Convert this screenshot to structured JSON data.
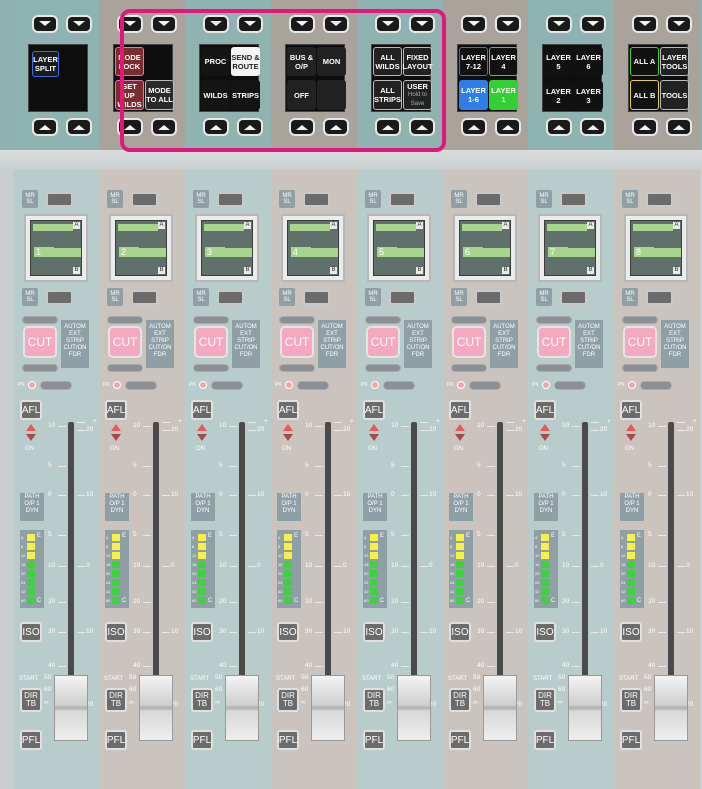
{
  "topbar": {
    "panels": [
      {
        "keys": [
          "LAYER SPLIT"
        ]
      },
      {
        "keys": [
          "MODE LOCK",
          "SET UP WILDS",
          "MODE TO ALL"
        ]
      },
      {
        "keys": [
          "PROC",
          "SEND & ROUTE",
          "WILDS",
          "STRIPS"
        ]
      },
      {
        "keys": [
          "BUS & O/P",
          "MON",
          "OFF"
        ]
      },
      {
        "keys": [
          "ALL WILDS",
          "FIXED LAYOUT",
          "ALL STRIPS",
          "USER",
          "Hold to Save"
        ]
      },
      {
        "keys": [
          "LAYER 7-12",
          "LAYER 4",
          "LAYER 1-6",
          "LAYER 1"
        ]
      },
      {
        "keys": [
          "LAYER 5",
          "LAYER 6",
          "LAYER 2",
          "LAYER 3"
        ]
      },
      {
        "keys": [
          "ALL A",
          "LAYER TOOLS",
          "ALL B",
          "TOOLS"
        ]
      }
    ],
    "highlight_color": "#e1187a"
  },
  "strips": {
    "channel_numbers": [
      "1",
      "2",
      "3",
      "4",
      "5",
      "6",
      "7",
      "8"
    ],
    "lcd_letters": {
      "a": "A",
      "b": "B"
    },
    "mr_sl": "MR SL",
    "cut_label": "CUT",
    "autom_label": "AUTOM EXT STRIP CUT/ON FDR",
    "pk_label": "PK",
    "afl_label": "AFL",
    "on_label": "ON",
    "path_label": "PATH O/P 1 DYN",
    "meter_labels": [
      "4",
      "8",
      "12",
      "16",
      "20",
      "24",
      "42",
      "60"
    ],
    "meter_letters": {
      "e": "E",
      "c": "C"
    },
    "iso_label": "ISO",
    "start_label": "START",
    "dirtb_label": "DIR TB",
    "pfl_label": "PFL",
    "scale_left": [
      "10",
      "5",
      "0",
      "5",
      "10",
      "20",
      "30",
      "40",
      "50",
      "60",
      "∞"
    ],
    "scale_right": [
      "+",
      "20",
      "10",
      "0",
      "10",
      "20"
    ]
  },
  "colors": {
    "cut": "#f4a9c0",
    "meter_yellow": "#f7f04a",
    "meter_green": "#3ed23e",
    "highlight": "#e1187a"
  }
}
